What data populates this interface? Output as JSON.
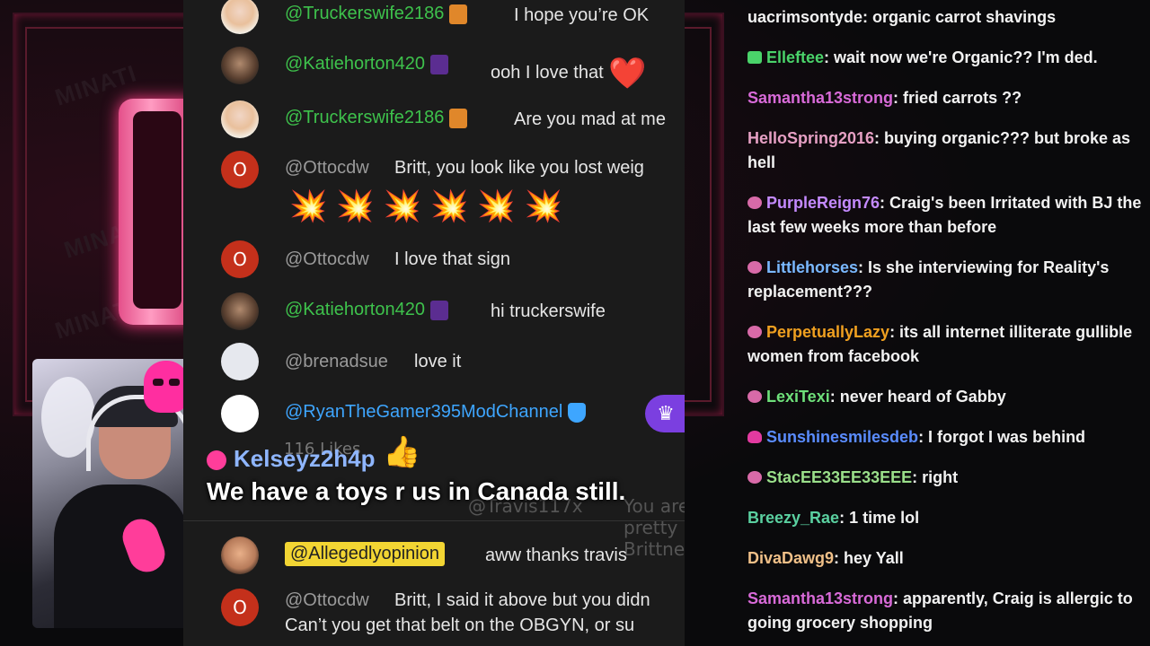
{
  "stream": {
    "watermark": "MINATI"
  },
  "yt_chat": {
    "rows": [
      {
        "user": "@Truckerswife2186",
        "message": "I hope you’re OK"
      },
      {
        "user": "@Katiehorton420",
        "message": "ooh I love that",
        "emoji": "❤️"
      },
      {
        "user": "@Truckerswife2186",
        "message": "Are you mad at me"
      },
      {
        "user": "@Ottocdw",
        "avatar_letter": "O",
        "message": "Britt, you look like you lost weig",
        "bursts": "💥💥💥💥💥💥"
      },
      {
        "user": "@Ottocdw",
        "avatar_letter": "O",
        "message": "I love that sign"
      },
      {
        "user": "@Katiehorton420",
        "message": "hi truckerswife"
      },
      {
        "user": "@brenadsue",
        "message": "love it"
      },
      {
        "user": "@RyanTheGamer395ModChannel",
        "message": ""
      },
      {
        "user": "@Allegedlyopinion",
        "message": "aww thanks travis"
      },
      {
        "user": "@Ottocdw",
        "avatar_letter": "O",
        "message": "Britt, I said it above but you didn",
        "message2": "Can’t you get that belt on the OBGYN, or su"
      }
    ],
    "crown_icon": "♛",
    "ghost_user": "@Travis117x",
    "ghost_message": "You are pretty Brittney"
  },
  "highlight": {
    "user": "Kelseyz2h4p",
    "likes": "116 Likes",
    "thumb_icon": "👍",
    "message": "We have a toys r us in Canada still."
  },
  "twitch_chat": {
    "lines": [
      {
        "icon": "",
        "user": "uacrimsontyde",
        "color": "#f2f2f2",
        "text": ": organic carrot shavings"
      },
      {
        "icon": "gift",
        "user": "Elleftee",
        "color": "#4ad36a",
        "text": ": wait now we're Organic?? I'm ded."
      },
      {
        "icon": "",
        "user": "Samantha13strong",
        "color": "#d86ad8",
        "text": ": fried carrots ??"
      },
      {
        "icon": "",
        "user": "HelloSpring2016",
        "color": "#e6a0c4",
        "text": ": buying organic??? but broke as hell"
      },
      {
        "icon": "brain",
        "user": "PurpleReign76",
        "color": "#c48aff",
        "text": ": Craig's been Irritated with BJ the last few weeks more than before"
      },
      {
        "icon": "brain",
        "user": "Littlehorses",
        "color": "#7ab8ff",
        "text": ": Is she interviewing for Reality's replacement???"
      },
      {
        "icon": "brain",
        "user": "PerpetuallyLazy",
        "color": "#f0a020",
        "text": ": its all internet illiterate gullible women from facebook"
      },
      {
        "icon": "brain",
        "user": "LexiTexi",
        "color": "#6ee07a",
        "text": ": never heard of Gabby"
      },
      {
        "icon": "skull",
        "user": "Sunshinesmilesdeb",
        "color": "#5a8cff",
        "text": ": I forgot I was behind"
      },
      {
        "icon": "brain",
        "user": "StacEE33EE33EEE",
        "color": "#9adf8a",
        "text": ": right"
      },
      {
        "icon": "",
        "user": "Breezy_Rae",
        "color": "#5ad0a0",
        "text": ": 1 time lol"
      },
      {
        "icon": "",
        "user": "DivaDawg9",
        "color": "#f0c088",
        "text": ": hey Yall"
      },
      {
        "icon": "",
        "user": "Samantha13strong",
        "color": "#d86ad8",
        "text": ": apparently, Craig is allergic to going grocery shopping"
      }
    ]
  }
}
